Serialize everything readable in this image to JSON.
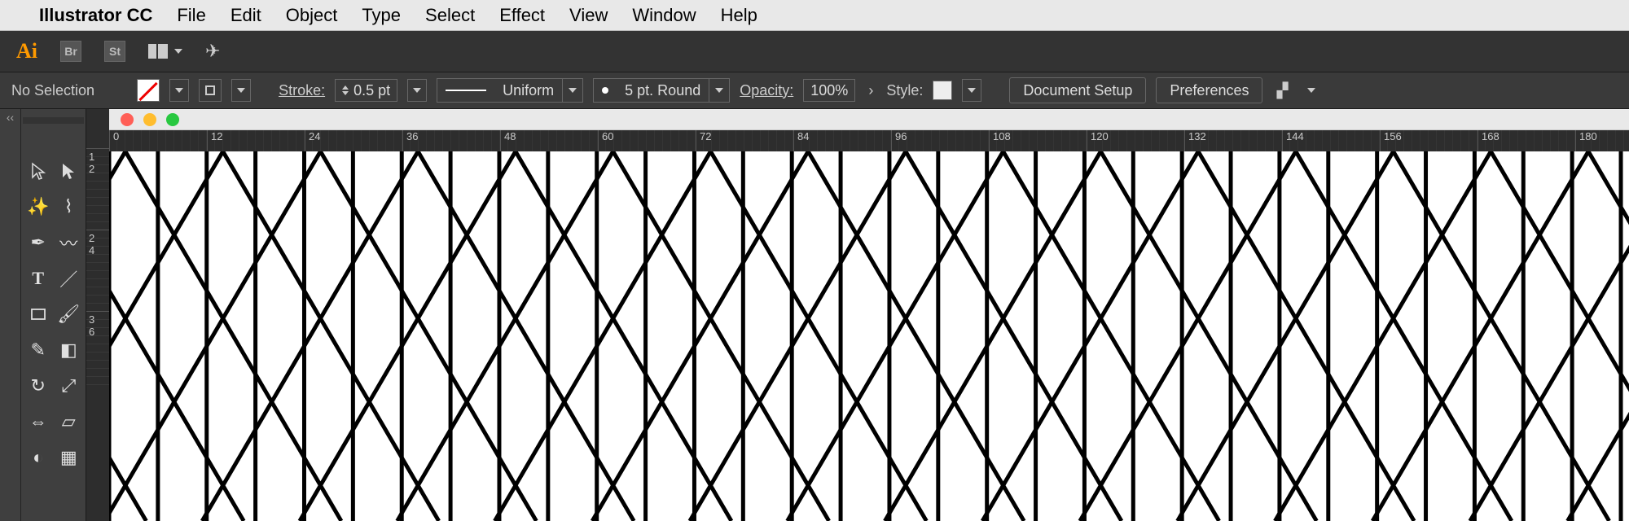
{
  "menubar": {
    "app_title": "Illustrator CC",
    "items": [
      "File",
      "Edit",
      "Object",
      "Type",
      "Select",
      "Effect",
      "View",
      "Window",
      "Help"
    ]
  },
  "appbar": {
    "ai_label": "Ai",
    "br_label": "Br",
    "st_label": "St"
  },
  "ctrlbar": {
    "selection_label": "No Selection",
    "stroke_label": "Stroke:",
    "stroke_value": "0.5 pt",
    "profile_value": "Uniform",
    "brush_value": "5 pt. Round",
    "opacity_label": "Opacity:",
    "opacity_value": "100%",
    "style_label": "Style:",
    "btn_doc_setup": "Document Setup",
    "btn_prefs": "Preferences"
  },
  "ruler": {
    "h": [
      "0",
      "12",
      "24",
      "36",
      "48",
      "60",
      "72",
      "84",
      "96",
      "108",
      "120",
      "132",
      "144",
      "156",
      "168",
      "180"
    ],
    "v": [
      {
        "top": "1",
        "bot": "2"
      },
      {
        "top": "2",
        "bot": "4"
      },
      {
        "top": "3",
        "bot": "6"
      }
    ]
  },
  "panel_strip": "‹‹"
}
